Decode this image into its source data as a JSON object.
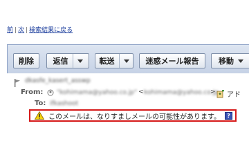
{
  "nav": {
    "prev": "前",
    "next": "次",
    "back_to_results": "検索結果に戻る"
  },
  "toolbar": {
    "delete": "削除",
    "reply": "返信",
    "forward": "転送",
    "report_spam": "迷惑メール報告",
    "move": "移動"
  },
  "header": {
    "subject": "dkasfe_kasert_asswp",
    "from_label": "From:",
    "from_name": "\"kohimama@yahoo.co.jp\"",
    "from_address": "kohimama@yahoo.co.jp",
    "add_address": "アド",
    "to_label": "To:",
    "to_value": "ifkashoot"
  },
  "warning": {
    "message": "このメールは、なりすましメールの可能性があります。",
    "help": "?"
  },
  "colors": {
    "warning_border": "#d61a1a",
    "toolbar_bg": "#c6d2e6",
    "link": "#1a3c9c"
  }
}
